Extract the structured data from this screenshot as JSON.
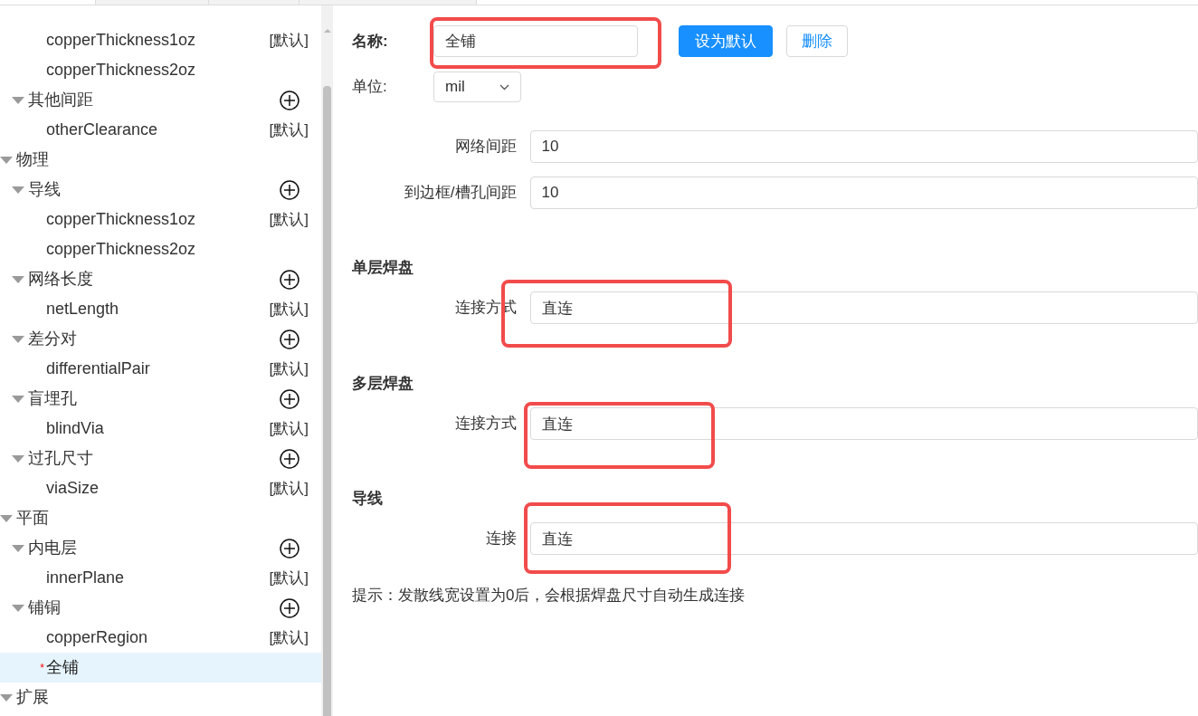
{
  "tree_top_rows": [
    {
      "label": "copperThickness1oz",
      "badge": "[默认]",
      "selected": false,
      "modified": false
    },
    {
      "label": "copperThickness2oz",
      "selected": false,
      "modified": false
    }
  ],
  "tree_partial_groups": [
    {
      "label": "其他间距",
      "expanded": true,
      "addable": true,
      "children": [
        {
          "label": "otherClearance",
          "badge": "[默认]",
          "selected": false,
          "modified": false
        }
      ]
    }
  ],
  "tree": [
    {
      "label": "物理",
      "expanded": true,
      "children": [
        {
          "label": "导线",
          "expanded": true,
          "addable": true,
          "children": [
            {
              "label": "copperThickness1oz",
              "badge": "[默认]",
              "selected": false,
              "modified": false
            },
            {
              "label": "copperThickness2oz",
              "selected": false,
              "modified": false
            }
          ]
        },
        {
          "label": "网络长度",
          "expanded": true,
          "addable": true,
          "children": [
            {
              "label": "netLength",
              "badge": "[默认]",
              "selected": false,
              "modified": false
            }
          ]
        },
        {
          "label": "差分对",
          "expanded": true,
          "addable": true,
          "children": [
            {
              "label": "differentialPair",
              "badge": "[默认]",
              "selected": false,
              "modified": false
            }
          ]
        },
        {
          "label": "盲埋孔",
          "expanded": true,
          "addable": true,
          "children": [
            {
              "label": "blindVia",
              "badge": "[默认]",
              "selected": false,
              "modified": false
            }
          ]
        },
        {
          "label": "过孔尺寸",
          "expanded": true,
          "addable": true,
          "children": [
            {
              "label": "viaSize",
              "badge": "[默认]",
              "selected": false,
              "modified": false
            }
          ]
        }
      ]
    },
    {
      "label": "平面",
      "expanded": true,
      "children": [
        {
          "label": "内电层",
          "expanded": true,
          "addable": true,
          "children": [
            {
              "label": "innerPlane",
              "badge": "[默认]",
              "selected": false,
              "modified": false
            }
          ]
        },
        {
          "label": "铺铜",
          "expanded": true,
          "addable": true,
          "children": [
            {
              "label": "copperRegion",
              "badge": "[默认]",
              "selected": false,
              "modified": false
            },
            {
              "label": "全铺",
              "selected": true,
              "modified": true,
              "modified_mark": "*"
            }
          ]
        }
      ]
    },
    {
      "label": "扩展",
      "expanded": true
    }
  ],
  "form": {
    "name_label": "名称:",
    "name_value": "全铺",
    "name_highlighted": true,
    "buttons": [
      {
        "label": "设为默认",
        "kind": "primary"
      },
      {
        "label": "删除",
        "kind": "secondary"
      }
    ],
    "unit_label": "单位:",
    "unit_value": "mil",
    "clearances": [
      {
        "label": "网络间距",
        "value": "10"
      },
      {
        "label": "到边框/槽孔间距",
        "value": "10"
      }
    ],
    "sections": [
      {
        "title": "单层焊盘",
        "field_label": "连接方式",
        "value": "直连",
        "highlighted": true
      },
      {
        "title": "多层焊盘",
        "field_label": "连接方式",
        "value": "直连",
        "highlighted": true
      },
      {
        "title": "导线",
        "field_label": "连接",
        "value": "直连",
        "highlighted": true
      }
    ],
    "hint": "提示：发散线宽设置为0后，会根据焊盘尺寸自动生成连接"
  }
}
